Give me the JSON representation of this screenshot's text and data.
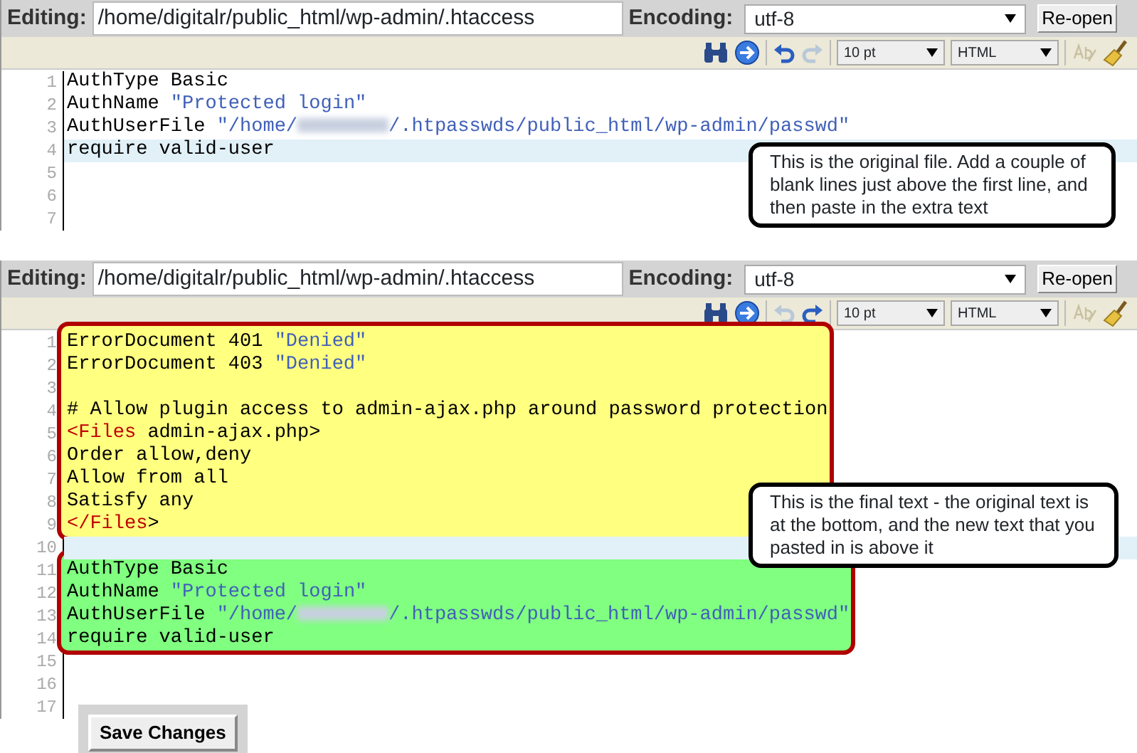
{
  "panels": [
    {
      "editing_label": "Editing:",
      "path": "/home/digitalr/public_html/wp-admin/.htaccess",
      "encoding_label": "Encoding:",
      "encoding": "utf-8",
      "reopen_button": "Re-open",
      "toolbar": {
        "undo_enabled": true,
        "redo_enabled": false,
        "font_size": "10 pt",
        "mode": "HTML"
      },
      "line_groups": [
        {
          "kind": "plain",
          "lines": [
            {
              "number": "1",
              "highlighted": false,
              "segments": [
                {
                  "kind": "text",
                  "text": "AuthType Basic"
                }
              ]
            },
            {
              "number": "2",
              "highlighted": false,
              "segments": [
                {
                  "kind": "text",
                  "text": "AuthName "
                },
                {
                  "kind": "string",
                  "text": "\"Protected login\""
                }
              ]
            },
            {
              "number": "3",
              "highlighted": false,
              "segments": [
                {
                  "kind": "text",
                  "text": "AuthUserFile "
                },
                {
                  "kind": "string",
                  "text": "\"/home/"
                },
                {
                  "kind": "redacted"
                },
                {
                  "kind": "string",
                  "text": "/.htpasswds/public_html/wp-admin/passwd\""
                }
              ]
            },
            {
              "number": "4",
              "highlighted": true,
              "segments": [
                {
                  "kind": "text",
                  "text": "require valid-user"
                }
              ]
            },
            {
              "number": "5",
              "highlighted": false
            },
            {
              "number": "6",
              "highlighted": false
            },
            {
              "number": "7",
              "highlighted": false
            }
          ]
        }
      ],
      "callout": "This is the original file. Add a couple of blank lines just above the first line, and then paste in the extra text"
    },
    {
      "editing_label": "Editing:",
      "path": "/home/digitalr/public_html/wp-admin/.htaccess",
      "encoding_label": "Encoding:",
      "encoding": "utf-8",
      "reopen_button": "Re-open",
      "toolbar": {
        "undo_enabled": false,
        "redo_enabled": true,
        "font_size": "10 pt",
        "mode": "HTML"
      },
      "line_groups": [
        {
          "kind": "boxed",
          "color": "#ffff80",
          "lines": [
            {
              "number": "1",
              "highlighted": false,
              "segments": [
                {
                  "kind": "text",
                  "text": "ErrorDocument 401 "
                },
                {
                  "kind": "string",
                  "text": "\"Denied\""
                }
              ]
            },
            {
              "number": "2",
              "highlighted": false,
              "segments": [
                {
                  "kind": "text",
                  "text": "ErrorDocument 403 "
                },
                {
                  "kind": "string",
                  "text": "\"Denied\""
                }
              ]
            },
            {
              "number": "3",
              "highlighted": false
            },
            {
              "number": "4",
              "highlighted": false,
              "segments": [
                {
                  "kind": "text",
                  "text": "# Allow plugin access to admin-ajax.php around password protection"
                }
              ]
            },
            {
              "number": "5",
              "highlighted": false,
              "segments": [
                {
                  "kind": "tag",
                  "text": "<Files"
                },
                {
                  "kind": "text",
                  "text": " admin-ajax.php>"
                }
              ]
            },
            {
              "number": "6",
              "highlighted": false,
              "segments": [
                {
                  "kind": "text",
                  "text": "Order allow,deny"
                }
              ]
            },
            {
              "number": "7",
              "highlighted": false,
              "segments": [
                {
                  "kind": "text",
                  "text": "Allow from all"
                }
              ]
            },
            {
              "number": "8",
              "highlighted": false,
              "segments": [
                {
                  "kind": "text",
                  "text": "Satisfy any"
                }
              ]
            },
            {
              "number": "9",
              "highlighted": false,
              "segments": [
                {
                  "kind": "tag",
                  "text": "</Files"
                },
                {
                  "kind": "text",
                  "text": ">"
                }
              ]
            }
          ]
        },
        {
          "kind": "plain",
          "lines": [
            {
              "number": "10",
              "highlighted": true
            }
          ]
        },
        {
          "kind": "boxed",
          "color": "#80ff80",
          "lines": [
            {
              "number": "11",
              "highlighted": false,
              "segments": [
                {
                  "kind": "text",
                  "text": "AuthType Basic"
                }
              ]
            },
            {
              "number": "12",
              "highlighted": false,
              "segments": [
                {
                  "kind": "text",
                  "text": "AuthName "
                },
                {
                  "kind": "string",
                  "text": "\"Protected login\""
                }
              ]
            },
            {
              "number": "13",
              "highlighted": false,
              "segments": [
                {
                  "kind": "text",
                  "text": "AuthUserFile "
                },
                {
                  "kind": "string",
                  "text": "\"/home/"
                },
                {
                  "kind": "redacted"
                },
                {
                  "kind": "string",
                  "text": "/.htpasswds/public_html/wp-admin/passwd\""
                }
              ]
            },
            {
              "number": "14",
              "highlighted": false,
              "segments": [
                {
                  "kind": "text",
                  "text": "require valid-user"
                }
              ]
            }
          ]
        },
        {
          "kind": "plain",
          "lines": [
            {
              "number": "15",
              "highlighted": false
            },
            {
              "number": "16",
              "highlighted": false
            },
            {
              "number": "17",
              "highlighted": false
            }
          ]
        }
      ],
      "callout": "This is the final text - the original text is at the bottom, and the new text that you pasted in is above it"
    }
  ],
  "save_button": "Save Changes"
}
